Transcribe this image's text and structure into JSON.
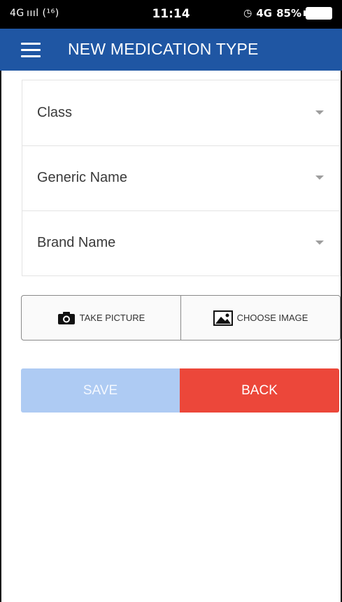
{
  "status_bar": {
    "network": "4G ıııl (¹⁶)",
    "time": "11:14",
    "network_right": "4G",
    "battery": "85%",
    "alarm_icon": "alarm-icon"
  },
  "app_bar": {
    "title": "NEW MEDICATION TYPE",
    "menu_icon": "hamburger-menu-icon",
    "color": "#1f56a3"
  },
  "form": {
    "fields": [
      {
        "label": "Class"
      },
      {
        "label": "Generic Name"
      },
      {
        "label": "Brand Name"
      }
    ]
  },
  "media": {
    "take_picture": "TAKE PICTURE",
    "choose_image": "CHOOSE IMAGE"
  },
  "actions": {
    "save": "SAVE",
    "back": "BACK",
    "save_color": "#aecbf3",
    "back_color": "#ec473a"
  }
}
